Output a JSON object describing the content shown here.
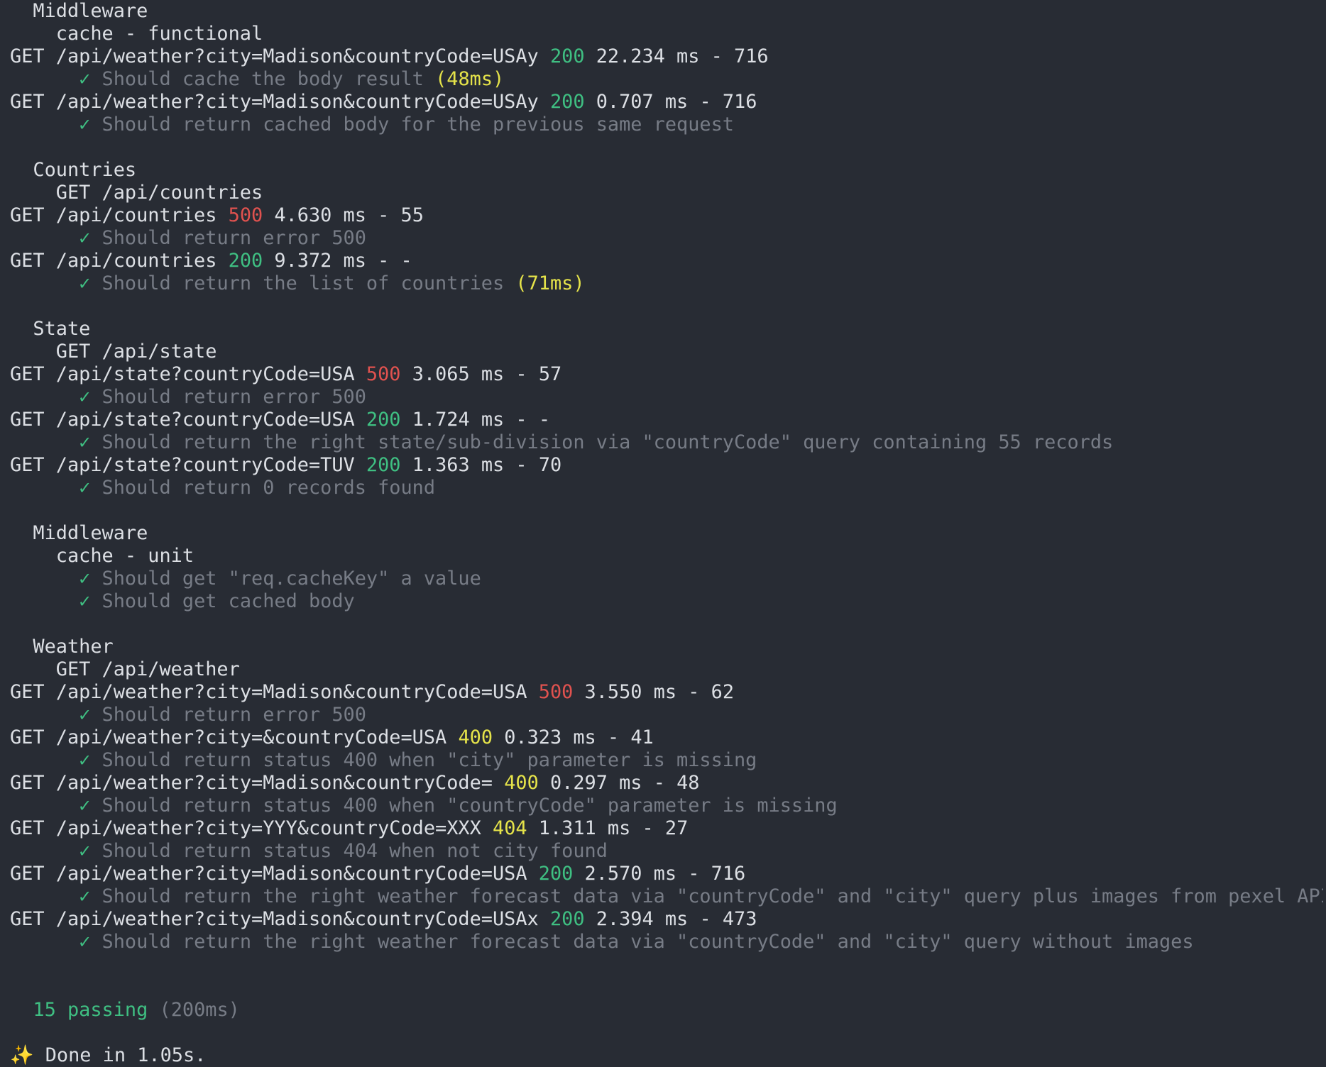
{
  "colors": {
    "background": "#282c34",
    "text": "#dcdfe4",
    "muted": "#777c86",
    "pass": "#3fbf82",
    "warn": "#e5e34a",
    "error": "#e0524f"
  },
  "check_mark": "✓",
  "lines": [
    {
      "kind": "suite",
      "indent": 2,
      "text": "Middleware"
    },
    {
      "kind": "suite",
      "indent": 4,
      "text": "cache - functional"
    },
    {
      "kind": "request",
      "method": "GET",
      "path": "/api/weather?city=Madison&countryCode=USAy",
      "status": "200",
      "time": "22.234 ms",
      "size": "716"
    },
    {
      "kind": "test",
      "title": "Should cache the body result",
      "duration": "(48ms)"
    },
    {
      "kind": "request",
      "method": "GET",
      "path": "/api/weather?city=Madison&countryCode=USAy",
      "status": "200",
      "time": "0.707 ms",
      "size": "716"
    },
    {
      "kind": "test",
      "title": "Should return cached body for the previous same request"
    },
    {
      "kind": "blank"
    },
    {
      "kind": "suite",
      "indent": 2,
      "text": "Countries"
    },
    {
      "kind": "suite",
      "indent": 4,
      "text": "GET /api/countries"
    },
    {
      "kind": "request",
      "method": "GET",
      "path": "/api/countries",
      "status": "500",
      "time": "4.630 ms",
      "size": "55"
    },
    {
      "kind": "test",
      "title": "Should return error 500"
    },
    {
      "kind": "request",
      "method": "GET",
      "path": "/api/countries",
      "status": "200",
      "time": "9.372 ms",
      "size": "-"
    },
    {
      "kind": "test",
      "title": "Should return the list of countries",
      "duration": "(71ms)"
    },
    {
      "kind": "blank"
    },
    {
      "kind": "suite",
      "indent": 2,
      "text": "State"
    },
    {
      "kind": "suite",
      "indent": 4,
      "text": "GET /api/state"
    },
    {
      "kind": "request",
      "method": "GET",
      "path": "/api/state?countryCode=USA",
      "status": "500",
      "time": "3.065 ms",
      "size": "57"
    },
    {
      "kind": "test",
      "title": "Should return error 500"
    },
    {
      "kind": "request",
      "method": "GET",
      "path": "/api/state?countryCode=USA",
      "status": "200",
      "time": "1.724 ms",
      "size": "-"
    },
    {
      "kind": "test",
      "title": "Should return the right state/sub-division via \"countryCode\" query containing 55 records"
    },
    {
      "kind": "request",
      "method": "GET",
      "path": "/api/state?countryCode=TUV",
      "status": "200",
      "time": "1.363 ms",
      "size": "70"
    },
    {
      "kind": "test",
      "title": "Should return 0 records found"
    },
    {
      "kind": "blank"
    },
    {
      "kind": "suite",
      "indent": 2,
      "text": "Middleware"
    },
    {
      "kind": "suite",
      "indent": 4,
      "text": "cache - unit"
    },
    {
      "kind": "test",
      "title": "Should get \"req.cacheKey\" a value"
    },
    {
      "kind": "test",
      "title": "Should get cached body"
    },
    {
      "kind": "blank"
    },
    {
      "kind": "suite",
      "indent": 2,
      "text": "Weather"
    },
    {
      "kind": "suite",
      "indent": 4,
      "text": "GET /api/weather"
    },
    {
      "kind": "request",
      "method": "GET",
      "path": "/api/weather?city=Madison&countryCode=USA",
      "status": "500",
      "time": "3.550 ms",
      "size": "62"
    },
    {
      "kind": "test",
      "title": "Should return error 500"
    },
    {
      "kind": "request",
      "method": "GET",
      "path": "/api/weather?city=&countryCode=USA",
      "status": "400",
      "time": "0.323 ms",
      "size": "41"
    },
    {
      "kind": "test",
      "title": "Should return status 400 when \"city\" parameter is missing"
    },
    {
      "kind": "request",
      "method": "GET",
      "path": "/api/weather?city=Madison&countryCode=",
      "status": "400",
      "time": "0.297 ms",
      "size": "48"
    },
    {
      "kind": "test",
      "title": "Should return status 400 when \"countryCode\" parameter is missing"
    },
    {
      "kind": "request",
      "method": "GET",
      "path": "/api/weather?city=YYY&countryCode=XXX",
      "status": "404",
      "time": "1.311 ms",
      "size": "27"
    },
    {
      "kind": "test",
      "title": "Should return status 404 when not city found"
    },
    {
      "kind": "request",
      "method": "GET",
      "path": "/api/weather?city=Madison&countryCode=USA",
      "status": "200",
      "time": "2.570 ms",
      "size": "716"
    },
    {
      "kind": "test",
      "title": "Should return the right weather forecast data via \"countryCode\" and \"city\" query plus images from pexel API"
    },
    {
      "kind": "request",
      "method": "GET",
      "path": "/api/weather?city=Madison&countryCode=USAx",
      "status": "200",
      "time": "2.394 ms",
      "size": "473"
    },
    {
      "kind": "test",
      "title": "Should return the right weather forecast data via \"countryCode\" and \"city\" query without images"
    },
    {
      "kind": "blank"
    },
    {
      "kind": "blank"
    },
    {
      "kind": "summary",
      "passing": "15 passing",
      "duration": "(200ms)"
    },
    {
      "kind": "blank"
    },
    {
      "kind": "done",
      "icon": "sparkles-icon",
      "glyph": "✨",
      "text": "Done in 1.05s."
    }
  ]
}
